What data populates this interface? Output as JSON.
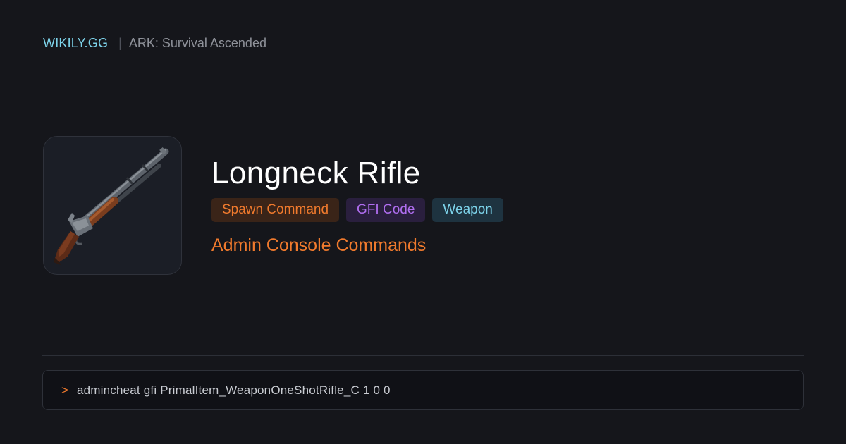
{
  "header": {
    "brand": "WIKILY.GG",
    "separator": "|",
    "game": "ARK: Survival Ascended"
  },
  "item": {
    "icon": "longneck-rifle-icon",
    "title": "Longneck Rifle",
    "badges": [
      {
        "label": "Spawn Command",
        "color": "#f07a2d"
      },
      {
        "label": "GFI Code",
        "color": "#b06ef0"
      },
      {
        "label": "Weapon",
        "color": "#7dd3ea"
      }
    ],
    "subtitle": "Admin Console Commands"
  },
  "console": {
    "prompt": ">",
    "command": "admincheat gfi PrimalItem_WeaponOneShotRifle_C 1 0 0"
  },
  "colors": {
    "background": "#15161b",
    "accent": "#f07a2d",
    "brand": "#7dd3ea"
  }
}
